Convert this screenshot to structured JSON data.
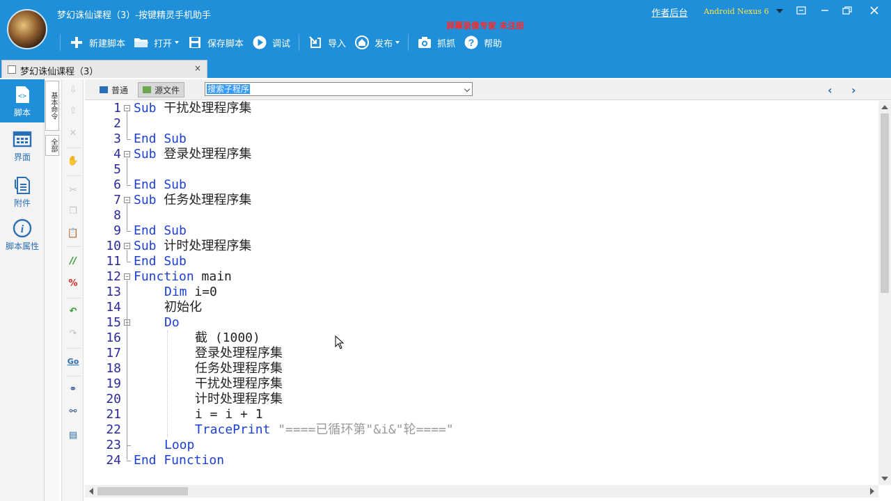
{
  "app": {
    "title": "梦幻诛仙课程（3）-按键精灵手机助手",
    "recording_notice": "屏幕录像专家  未注册",
    "author_link": "作者后台",
    "device": "Android  Nexus 6"
  },
  "toolbar": {
    "items": [
      {
        "label": "新建脚本",
        "icon": "plus-icon"
      },
      {
        "label": "打开",
        "icon": "folder-icon",
        "dropdown": true
      },
      {
        "label": "保存脚本",
        "icon": "save-icon"
      },
      {
        "label": "调试",
        "icon": "play-icon"
      },
      {
        "label": "导入",
        "icon": "import-icon"
      },
      {
        "label": "发布",
        "icon": "publish-icon",
        "dropdown": true
      },
      {
        "label": "抓抓",
        "icon": "camera-icon"
      },
      {
        "label": "帮助",
        "icon": "help-icon"
      }
    ]
  },
  "tab": {
    "label": "梦幻诛仙课程（3）",
    "close": "×"
  },
  "sidebar": {
    "items": [
      {
        "label": "脚本",
        "icon": "script-icon",
        "active": true
      },
      {
        "label": "界面",
        "icon": "layout-icon",
        "active": false
      },
      {
        "label": "附件",
        "icon": "attachment-icon",
        "active": false
      },
      {
        "label": "脚本属性",
        "icon": "info-icon",
        "active": false
      }
    ]
  },
  "vertical_tabs": {
    "commands": "基本命令",
    "full": "全部"
  },
  "editor_header": {
    "normal_mode": "普通",
    "source_mode": "源文件",
    "search_value": "搜索子程序"
  },
  "code": {
    "line_numbers": [
      "1",
      "2",
      "3",
      "4",
      "5",
      "6",
      "7",
      "8",
      "9",
      "10",
      "11",
      "12",
      "13",
      "14",
      "15",
      "16",
      "17",
      "18",
      "19",
      "20",
      "21",
      "22",
      "23",
      "24"
    ],
    "lines": [
      {
        "kw": "Sub",
        "text": " 干扰处理程序集",
        "indent": 0
      },
      {
        "kw": "",
        "text": "",
        "indent": 0
      },
      {
        "kw": "End Sub",
        "text": "",
        "indent": 0
      },
      {
        "kw": "Sub",
        "text": " 登录处理程序集",
        "indent": 0
      },
      {
        "kw": "",
        "text": "",
        "indent": 0
      },
      {
        "kw": "End Sub",
        "text": "",
        "indent": 0
      },
      {
        "kw": "Sub",
        "text": " 任务处理程序集",
        "indent": 0
      },
      {
        "kw": "",
        "text": "",
        "indent": 0
      },
      {
        "kw": "End Sub",
        "text": "",
        "indent": 0
      },
      {
        "kw": "Sub",
        "text": " 计时处理程序集",
        "indent": 0
      },
      {
        "kw": "End Sub",
        "text": "",
        "indent": 0
      },
      {
        "kw": "Function",
        "text": " main",
        "indent": 0
      },
      {
        "kw": "Dim",
        "text": " i=0",
        "indent": 1
      },
      {
        "kw": "",
        "text": "初始化",
        "indent": 1
      },
      {
        "kw": "Do",
        "text": "",
        "indent": 1
      },
      {
        "kw": "",
        "text": "截 (1000)",
        "indent": 2
      },
      {
        "kw": "",
        "text": "登录处理程序集",
        "indent": 2
      },
      {
        "kw": "",
        "text": "任务处理程序集",
        "indent": 2
      },
      {
        "kw": "",
        "text": "干扰处理程序集",
        "indent": 2
      },
      {
        "kw": "",
        "text": "计时处理程序集",
        "indent": 2
      },
      {
        "kw": "",
        "text": "i = i + 1",
        "indent": 2
      },
      {
        "kw": "TracePrint",
        "text": " \"====已循环第\"&i&\"轮====\"",
        "indent": 2,
        "string_part": true
      },
      {
        "kw": "Loop",
        "text": "",
        "indent": 1
      },
      {
        "kw": "End Function",
        "text": "",
        "indent": 0
      }
    ]
  },
  "colors": {
    "brand": "#1e8fd8",
    "keyword": "#1c3fd6",
    "string": "#9a9a9a",
    "line_number": "#2a2a9a",
    "recording_notice": "#ff2a2a",
    "device_label": "#ffe34d"
  }
}
